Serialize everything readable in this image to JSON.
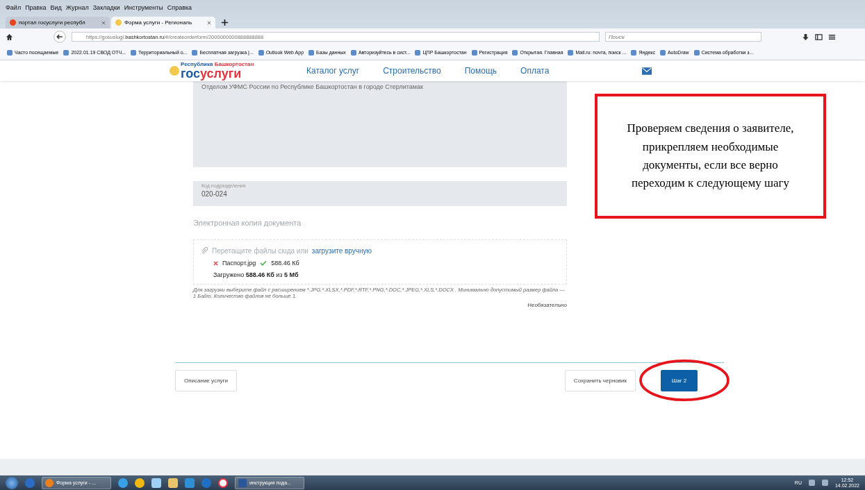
{
  "menu_bar": [
    "Файл",
    "Правка",
    "Вид",
    "Журнал",
    "Закладки",
    "Инструменты",
    "Справка"
  ],
  "tabs": [
    {
      "label": "портал госуслуги республ",
      "selected": false,
      "kind": "yandex"
    },
    {
      "label": "Форма услуги - Региональ",
      "selected": true,
      "kind": "gosuslugi"
    }
  ],
  "address_bar": {
    "url_prefix": "https://gosuslugi.",
    "url_domain": "bashkortostan.ru",
    "url_path": "/#/createorderform/2000000000888888888"
  },
  "search": {
    "placeholder": "Поиск"
  },
  "bookmarks": [
    "Часто посещаемые",
    "2022.01.19 СВОД ОТЧ...",
    "Территориальный о...",
    "Бесплатная загрузка |...",
    "Outlook Web App",
    "Базы данных",
    "Авторизуйтесь в сист...",
    "ЦПР Башкортостан",
    "Регистрация",
    "Открытая. Главная",
    "Mail.ru: почта, поиск ...",
    "Яндекс",
    "AutoDraw",
    "Система обработки з..."
  ],
  "site_header": {
    "logo_region": "Республика",
    "logo_region_name": "Башкортостан",
    "logo_part1": "гос",
    "logo_part2": "услуги",
    "nav": [
      "Каталог услуг",
      "Строительство",
      "Помощь",
      "Оплата"
    ]
  },
  "form": {
    "issued_by": "Отделом УФМС России по Республике Башкортостан в городе Стерлитамак",
    "code_field": {
      "label": "Код подразделения",
      "value": "020-024"
    },
    "upload": {
      "title": "Электронная копия документа",
      "drop_text": "Перетащите файлы сюда или",
      "link": "загрузите вручную",
      "files": [
        {
          "name": "Паспорт.jpg",
          "size": "588.46 Кб",
          "uploaded": true
        }
      ],
      "summary": "Загружено **588.46 Кб** из **5 Мб**"
    },
    "hint": "Для загрузки выберите файл с расширением *.JPG,*.XLSX,*.PDF,*.RTF,*.PNG,*.DOC,*.JPEG,*.XLS,*.DOCX . Минимально допустимый размер файла — 1 Байт. Количество файлов не больше 1.",
    "optional": "Необязательно"
  },
  "buttons": {
    "back": "Описание услуги",
    "draft": "Сохранить черновик",
    "next": "Шаг 2"
  },
  "callout": "Проверяем сведения о заявителе, прикрепляем необходимые документы, если все верно переходим к следующему шагу",
  "taskbar": {
    "items": [
      {
        "kind": "firefox",
        "label": "Форма услуги - ..."
      },
      {
        "kind": "word",
        "label": "инструкция пода..."
      }
    ],
    "language": "RU",
    "time": "12:52",
    "date": "14.02.2022"
  }
}
